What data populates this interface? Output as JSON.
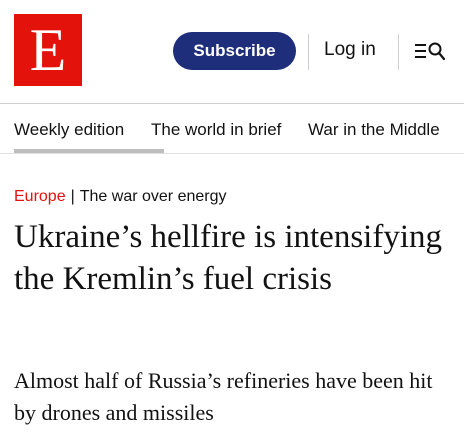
{
  "brand": {
    "logo_letter": "E",
    "color": "#e3120b"
  },
  "header": {
    "subscribe_label": "Subscribe",
    "subscribe_color": "#1f2e7a",
    "login_label": "Log in",
    "menu_icon": "menu-search-icon"
  },
  "nav": {
    "items": [
      {
        "label": "Weekly edition"
      },
      {
        "label": "The world in brief"
      },
      {
        "label": "War in the Middle"
      }
    ]
  },
  "article": {
    "section": "Europe",
    "separator": "|",
    "topic": "The war over energy",
    "headline": "Ukraine’s hellfire is intensifying the Kremlin’s fuel crisis",
    "standfirst": "Almost half of Russia’s refineries have been hit by drones and missiles"
  }
}
